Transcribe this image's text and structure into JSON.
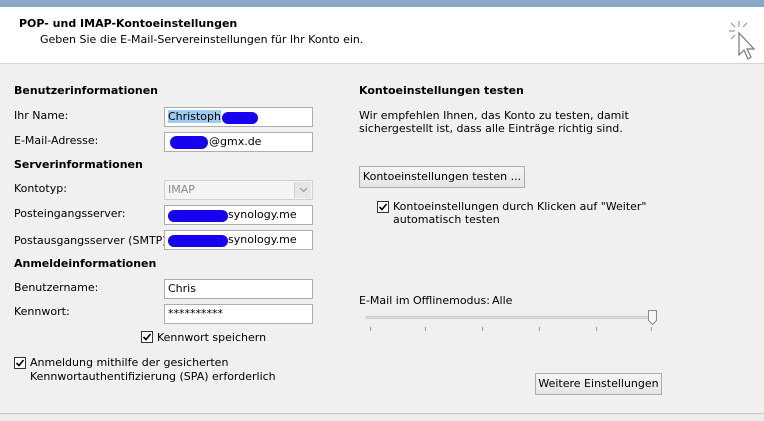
{
  "header": {
    "title": "POP- und IMAP-Kontoeinstellungen",
    "subtitle": "Geben Sie die E-Mail-Servereinstellungen für Ihr Konto ein."
  },
  "user_info": {
    "heading": "Benutzerinformationen",
    "name_label": "Ihr Name:",
    "name_value": "Christoph",
    "email_label": "E-Mail-Adresse:",
    "email_value": "@gmx.de"
  },
  "server_info": {
    "heading": "Serverinformationen",
    "account_type_label": "Kontotyp:",
    "account_type_value": "IMAP",
    "incoming_label": "Posteingangsserver:",
    "incoming_value": "synology.me",
    "outgoing_label": "Postausgangsserver (SMTP):",
    "outgoing_value": "synology.me"
  },
  "login_info": {
    "heading": "Anmeldeinformationen",
    "username_label": "Benutzername:",
    "username_value": "Chris",
    "password_label": "Kennwort:",
    "password_value": "**********",
    "remember_label": "Kennwort speichern",
    "remember_checked": true,
    "spa_label_line1": "Anmeldung mithilfe der gesicherten",
    "spa_label_line2": "Kennwortauthentifizierung (SPA) erforderlich",
    "spa_checked": true
  },
  "test": {
    "heading": "Kontoeinstellungen testen",
    "desc_line1": "Wir empfehlen Ihnen, das Konto zu testen, damit",
    "desc_line2": "sichergestellt ist, dass alle Einträge richtig sind.",
    "test_button": "Kontoeinstellungen testen ...",
    "auto_label_line1": "Kontoeinstellungen durch Klicken auf \"Weiter\"",
    "auto_label_line2": "automatisch testen",
    "auto_checked": true
  },
  "offline": {
    "label": "E-Mail im Offlinemodus:",
    "value": "Alle",
    "slider_level": 1.0
  },
  "more_settings_button": "Weitere Einstellungen",
  "colors": {
    "selection": "#9ecbf1",
    "redaction": "#1700ee",
    "title_strip": "#8aa6c6"
  }
}
